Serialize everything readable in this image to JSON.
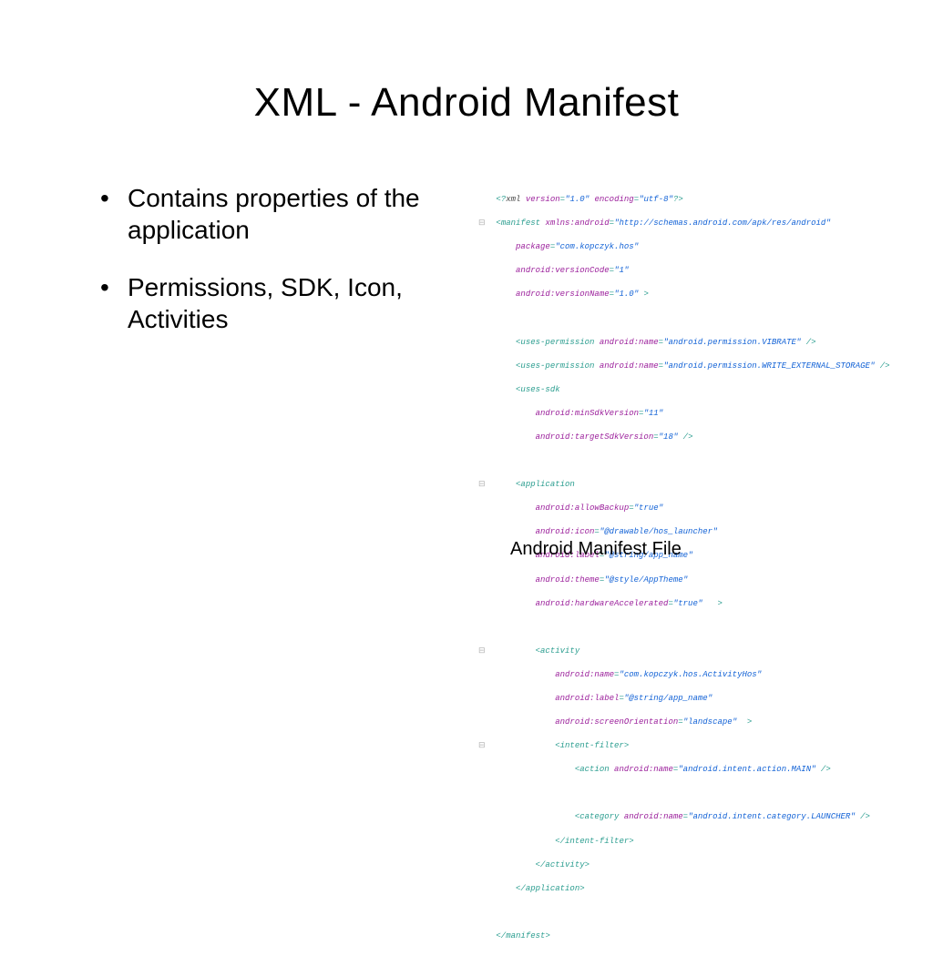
{
  "title": "XML - Android Manifest",
  "bullets": [
    "Contains properties of the application",
    "Permissions, SDK, Icon, Activities"
  ],
  "caption": "Android Manifest File",
  "xml": {
    "declaration": {
      "version": "1.0",
      "encoding": "utf-8"
    },
    "manifest": {
      "xmlns_android": "http://schemas.android.com/apk/res/android",
      "package": "com.kopczyk.hos",
      "versionCode": "1",
      "versionName": "1.0",
      "uses_permission": [
        "android.permission.VIBRATE",
        "android.permission.WRITE_EXTERNAL_STORAGE"
      ],
      "uses_sdk": {
        "minSdkVersion": "11",
        "targetSdkVersion": "18"
      },
      "application": {
        "allowBackup": "true",
        "icon": "@drawable/hos_launcher",
        "label": "@string/app_name",
        "theme": "@style/AppTheme",
        "hardwareAccelerated": "true",
        "activity": {
          "name": "com.kopczyk.hos.ActivityHos",
          "label": "@string/app_name",
          "screenOrientation": "landscape",
          "intent_filter": {
            "action_name": "android.intent.action.MAIN",
            "category_name": "android.intent.category.LAUNCHER"
          }
        }
      }
    }
  }
}
